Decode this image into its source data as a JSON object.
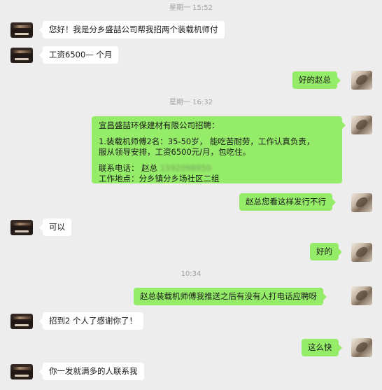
{
  "timestamps": [
    "星期一 15:52",
    "星期一 16:32",
    "10:34"
  ],
  "messages": [
    {
      "side": "in",
      "text": "您好！我是分乡盛喆公司帮我招两个装载机师付"
    },
    {
      "side": "in",
      "text": "工资6500— 个月"
    },
    {
      "side": "out",
      "text": "好的赵总"
    },
    {
      "side": "out",
      "lines": [
        "宜昌盛喆环保建材有限公司招聘：",
        "1.装载机师傅2名：35-50岁，  能吃苦耐劳，工作认真负责，",
        "服从领导安排，工资6500元/月，包吃住。",
        "联系电话：  赵总",
        "工作地点：分乡镇分乡场社区二组"
      ],
      "phone_redacted": "1592098950"
    },
    {
      "side": "out",
      "text": "赵总您看这样发行不行"
    },
    {
      "side": "in",
      "text": "可以"
    },
    {
      "side": "out",
      "text": "好的"
    },
    {
      "side": "out",
      "text": "赵总装载机师傅我推送之后有没有人打电话应聘呀"
    },
    {
      "side": "in",
      "text": "招到2 个人了感谢你了！"
    },
    {
      "side": "out",
      "text": "这么快"
    },
    {
      "side": "in",
      "text": "你一发就满多的人联系我"
    }
  ],
  "colors": {
    "background": "#ededed",
    "bubble_in": "#ffffff",
    "bubble_out": "#95ec69",
    "timestamp": "#a0a0a0"
  }
}
